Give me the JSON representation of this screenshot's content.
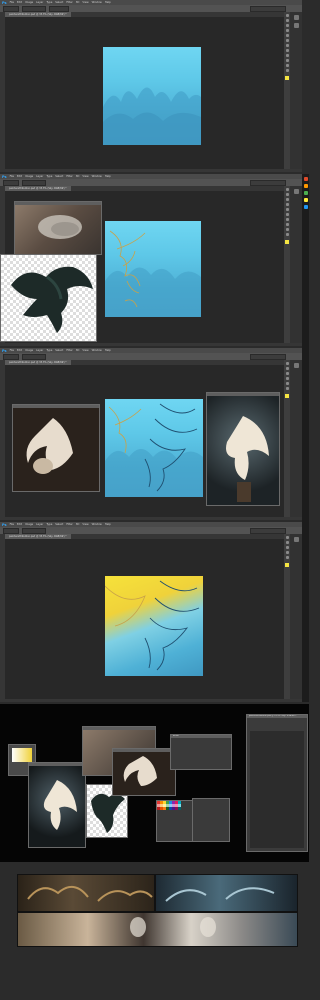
{
  "menu": [
    "File",
    "Edit",
    "Image",
    "Layer",
    "Type",
    "Select",
    "Filter",
    "3D",
    "View",
    "Window",
    "Help"
  ],
  "app_logo": "Ps",
  "document_tab": "painterattribution.psd @ 33.3% (Sky, RGB/8#) *",
  "brush_window_title": "Brush",
  "colors": {
    "accent_blue": "#31a8ff",
    "sky_light": "#6fd6f2",
    "sky_dark": "#4da7cf",
    "foreground_swatch": "#f5e542",
    "sketch_line": "#c8a24a",
    "canvas_bg": "#282828"
  },
  "icons": [
    "move-icon",
    "marquee-icon",
    "lasso-icon",
    "crop-icon",
    "eyedropper-icon",
    "brush-icon",
    "eraser-icon",
    "gradient-icon",
    "pen-icon",
    "type-icon",
    "hand-icon",
    "zoom-icon"
  ],
  "steps": [
    {
      "label": "step-1-sky-base"
    },
    {
      "label": "step-2-raven-reference"
    },
    {
      "label": "step-3-owl-sketch"
    },
    {
      "label": "step-4-color-block"
    }
  ]
}
